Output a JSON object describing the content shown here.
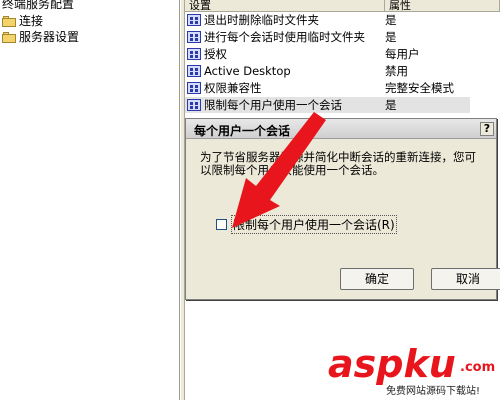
{
  "tree": {
    "items": [
      {
        "label": "终端服务配置"
      },
      {
        "label": "连接"
      },
      {
        "label": "服务器设置"
      }
    ]
  },
  "list": {
    "col_setting": "设置",
    "col_attr": "属性",
    "rows": [
      {
        "name": "退出时删除临时文件夹",
        "attr": "是"
      },
      {
        "name": "进行每个会话时使用临时文件夹",
        "attr": "是"
      },
      {
        "name": "授权",
        "attr": "每用户"
      },
      {
        "name": "Active Desktop",
        "attr": "禁用"
      },
      {
        "name": "权限兼容性",
        "attr": "完整安全模式"
      },
      {
        "name": "限制每个用户使用一个会话",
        "attr": "是"
      }
    ]
  },
  "dialog": {
    "title": "每个用户一个会话",
    "help": "?",
    "desc_line1": "为了节省服务器资源并简化中断会话的重新连接，您可",
    "desc_line2": "以限制每个用户只能使用一个会话。",
    "checkbox_label": "限制每个用户使用一个会话(R)",
    "ok": "确定",
    "cancel": "取消"
  },
  "watermark": {
    "logo": "aspku",
    "domain_suffix": ".com",
    "tagline": "免费网站源码下载站!"
  },
  "colors": {
    "arrow": "#e8161c",
    "selection": "#316ac5",
    "watermark": "#e8161c"
  }
}
